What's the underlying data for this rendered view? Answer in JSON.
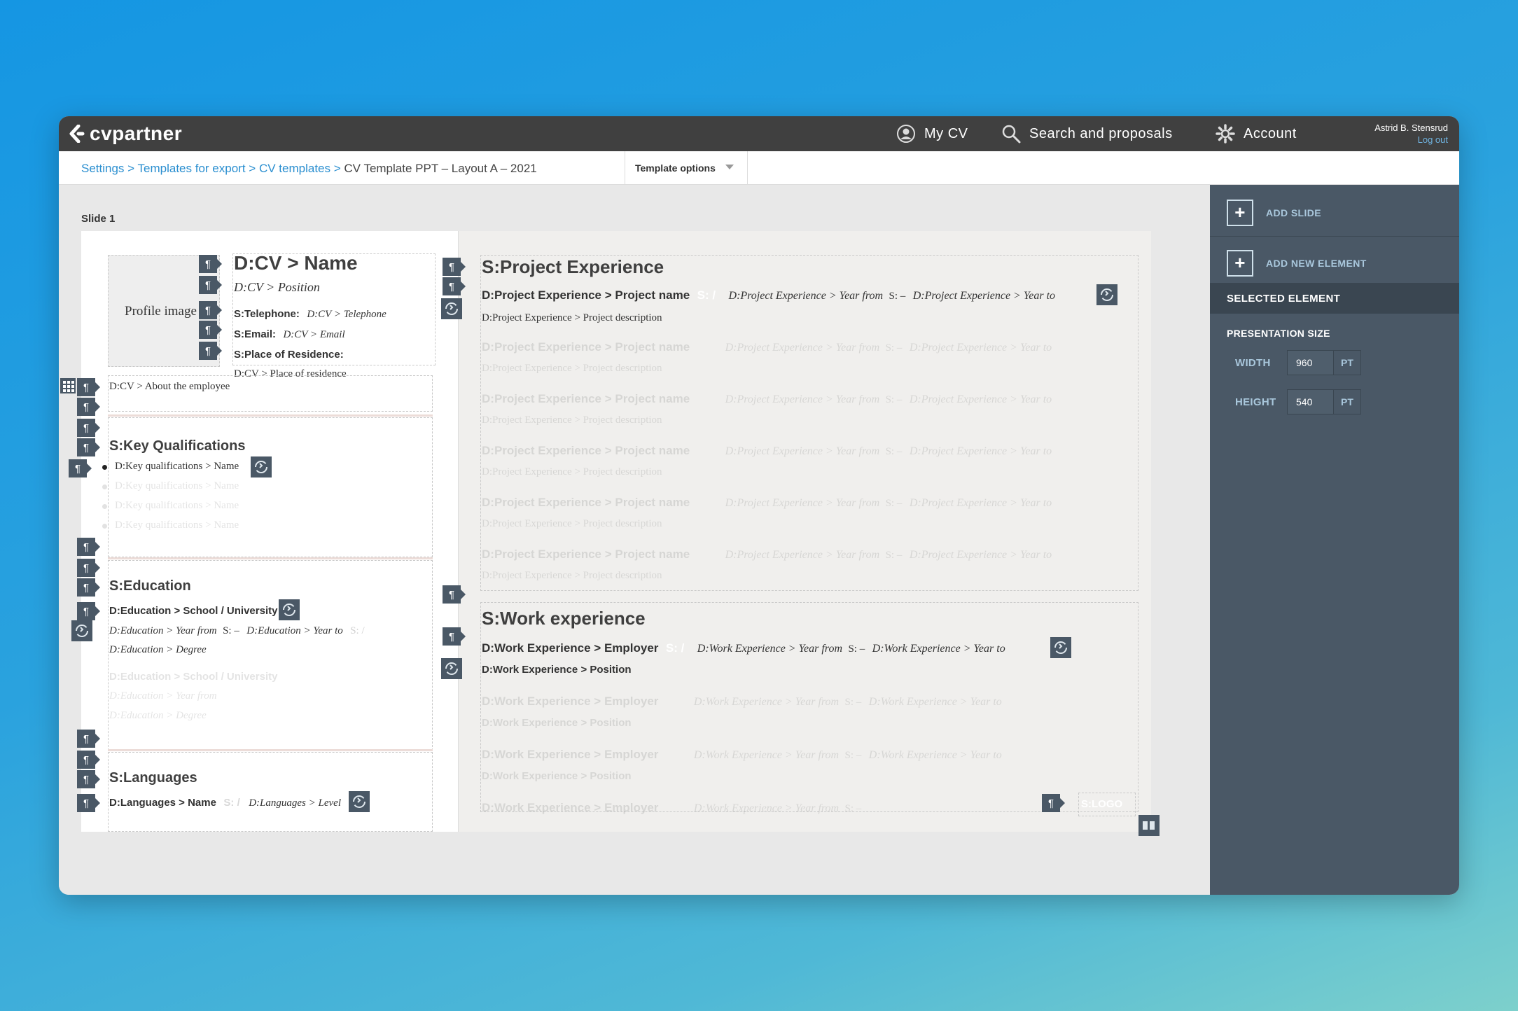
{
  "app": {
    "logo_text": "cvpartner"
  },
  "nav": {
    "my_cv": "My CV",
    "search": "Search and proposals",
    "account": "Account"
  },
  "user": {
    "name": "Astrid B. Stensrud",
    "logout": "Log out"
  },
  "breadcrumb": {
    "settings": "Settings",
    "sep": ">",
    "templates": "Templates for export",
    "cv_templates": "CV templates",
    "current": "CV Template PPT – Layout A – 2021"
  },
  "template_options": "Template options",
  "slide_label": "Slide 1",
  "left": {
    "profile_image": "Profile image",
    "name": "D:CV > Name",
    "position": "D:CV > Position",
    "telephone_label": "S:Telephone:",
    "telephone_value": "D:CV > Telephone",
    "email_label": "S:Email:",
    "email_value": "D:CV > Email",
    "residence_label": "S:Place of Residence:",
    "residence_value": "D:CV > Place of residence",
    "about": "D:CV > About the employee",
    "key_qual_title": "S:Key Qualifications",
    "key_qual_item": "D:Key qualifications > Name",
    "education_title": "S:Education",
    "edu_school": "D:Education > School / University",
    "edu_year_from": "D:Education > Year from",
    "edu_dash": "S: –",
    "edu_year_to": "D:Education > Year to",
    "edu_slash": "S: /",
    "edu_degree": "D:Education > Degree",
    "languages_title": "S:Languages",
    "lang_name": "D:Languages > Name",
    "lang_slash": "S: /",
    "lang_level": "D:Languages > Level"
  },
  "right": {
    "project_title": "S:Project Experience",
    "proj_name": "D:Project Experience > Project name",
    "proj_slash": "S: /",
    "proj_year_from": "D:Project Experience > Year from",
    "proj_dash": "S: –",
    "proj_year_to": "D:Project Experience > Year to",
    "proj_desc": "D:Project Experience > Project description",
    "work_title": "S:Work experience",
    "work_employer": "D:Work Experience > Employer",
    "work_slash": "S: /",
    "work_year_from": "D:Work Experience > Year from",
    "work_dash": "S: –",
    "work_year_to": "D:Work Experience > Year to",
    "work_position": "D:Work Experience > Position",
    "logo": "S:LOGO"
  },
  "sidepanel": {
    "add_slide": "ADD SLIDE",
    "add_element": "ADD NEW ELEMENT",
    "selected_element": "SELECTED ELEMENT",
    "presentation_size": "PRESENTATION SIZE",
    "width_label": "WIDTH",
    "width_value": "960",
    "height_label": "HEIGHT",
    "height_value": "540",
    "unit": "PT"
  },
  "icons": {
    "paragraph": "¶",
    "plus": "+"
  }
}
